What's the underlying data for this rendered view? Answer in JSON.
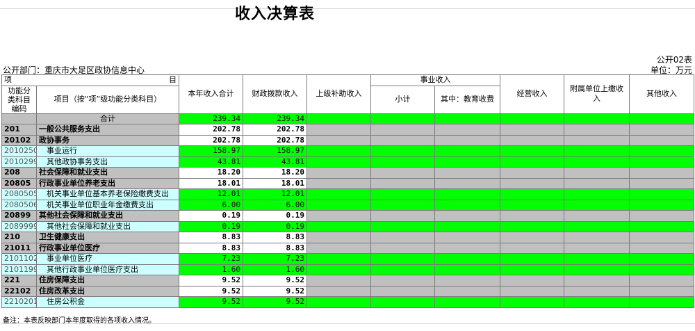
{
  "title": "收入决算表",
  "form_id": "公开02表",
  "department": "公开部门：重庆市大足区政协信息中心",
  "unit": "单位：万元",
  "headers": {
    "xiang": "项",
    "mu": "目",
    "code": "功能分类科目编码",
    "name": "项目（按“项”级功能分类科目）",
    "total": "本年收入合计",
    "fiscal": "财政拨款收入",
    "superior": "上级补助收入",
    "business_group": "事业收入",
    "business_sub": "小计",
    "business_edu": "其中：教育收费",
    "operating": "经营收入",
    "affiliated": "附属单位上缴收入",
    "other": "其他收入"
  },
  "total_row": {
    "label": "合计",
    "total": "239.34",
    "fiscal": "239.34"
  },
  "rows": [
    {
      "code": "201",
      "name": "一般公共服务支出",
      "total": "202.78",
      "fiscal": "202.78",
      "style": "b"
    },
    {
      "code": "20102",
      "name": "政协事务",
      "total": "202.78",
      "fiscal": "202.78",
      "style": "b"
    },
    {
      "code": "2010250",
      "name": "事业运行",
      "total": "158.97",
      "fiscal": "158.97",
      "style": "d"
    },
    {
      "code": "2010299",
      "name": "其他政协事务支出",
      "total": "43.81",
      "fiscal": "43.81",
      "style": "d"
    },
    {
      "code": "208",
      "name": "社会保障和就业支出",
      "total": "18.20",
      "fiscal": "18.20",
      "style": "b"
    },
    {
      "code": "20805",
      "name": "行政事业单位养老支出",
      "total": "18.01",
      "fiscal": "18.01",
      "style": "b"
    },
    {
      "code": "2080505",
      "name": "机关事业单位基本养老保险缴费支出",
      "total": "12.01",
      "fiscal": "12.01",
      "style": "d"
    },
    {
      "code": "2080506",
      "name": "机关事业单位职业年金缴费支出",
      "total": "6.00",
      "fiscal": "6.00",
      "style": "d"
    },
    {
      "code": "20899",
      "name": "其他社会保障和就业支出",
      "total": "0.19",
      "fiscal": "0.19",
      "style": "b"
    },
    {
      "code": "2089999",
      "name": "其他社会保障和就业支出",
      "total": "0.19",
      "fiscal": "0.19",
      "style": "d"
    },
    {
      "code": "210",
      "name": "卫生健康支出",
      "total": "8.83",
      "fiscal": "8.83",
      "style": "b"
    },
    {
      "code": "21011",
      "name": "行政事业单位医疗",
      "total": "8.83",
      "fiscal": "8.83",
      "style": "b"
    },
    {
      "code": "2101102",
      "name": "事业单位医疗",
      "total": "7.23",
      "fiscal": "7.23",
      "style": "d"
    },
    {
      "code": "2101199",
      "name": "其他行政事业单位医疗支出",
      "total": "1.60",
      "fiscal": "1.60",
      "style": "d"
    },
    {
      "code": "221",
      "name": "住房保障支出",
      "total": "9.52",
      "fiscal": "9.52",
      "style": "b"
    },
    {
      "code": "22102",
      "name": "住房改革支出",
      "total": "9.52",
      "fiscal": "9.52",
      "style": "b"
    },
    {
      "code": "2210201",
      "name": "住房公积金",
      "total": "9.52",
      "fiscal": "9.52",
      "style": "d"
    }
  ],
  "note": "备注：本表反映部门本年度取得的各项收入情况。",
  "colors": {
    "green": "#00ff00",
    "gray": "#c0c0c0",
    "cyan": "#ccffff"
  }
}
